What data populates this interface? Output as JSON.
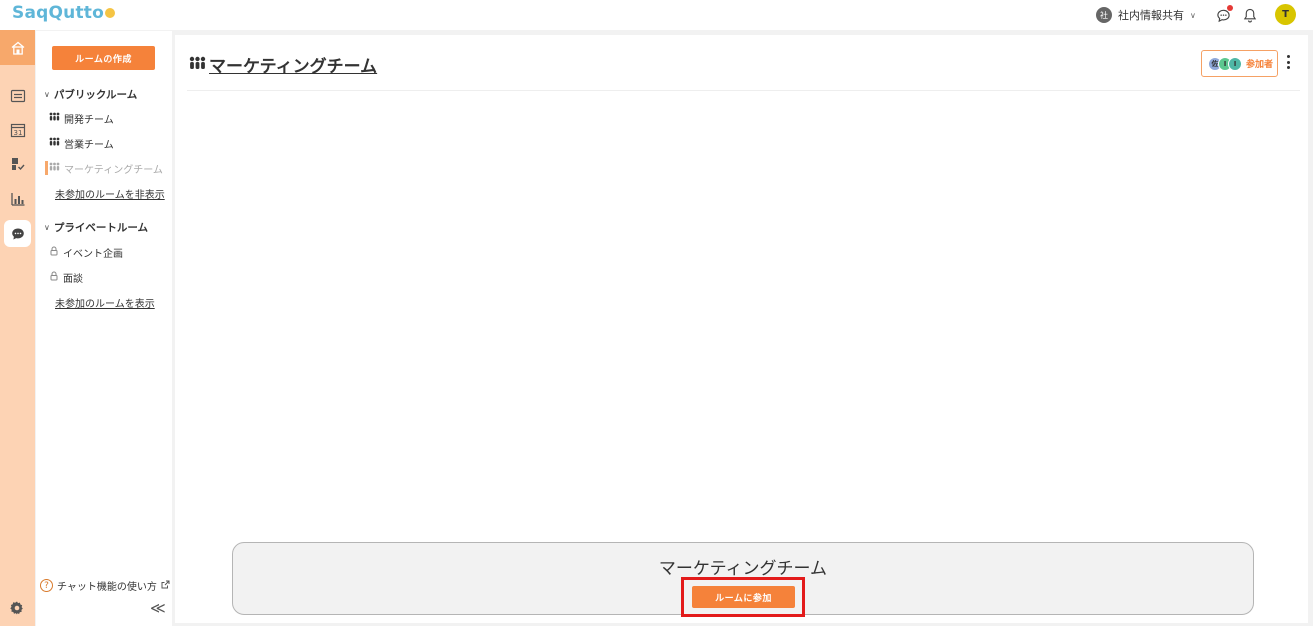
{
  "app": {
    "logo_text": "SaqQutto"
  },
  "topbar": {
    "workspace_badge": "社",
    "workspace_name": "社内情報共有",
    "user_initial": "T"
  },
  "rail": {
    "items": [
      "home-icon",
      "list-icon",
      "calendar-icon",
      "task-icon",
      "chart-icon",
      "chat-icon",
      "gear-icon"
    ],
    "calendar_number": "31"
  },
  "sidebar": {
    "create_room": "ルームの作成",
    "public_section": "パブリックルーム",
    "public_rooms": [
      "開発チーム",
      "営業チーム",
      "マーケティングチーム"
    ],
    "hide_unjoined": "未参加のルームを非表示",
    "private_section": "プライベートルーム",
    "private_rooms": [
      "イベント企画",
      "面談"
    ],
    "show_unjoined": "未参加のルームを表示",
    "help": "チャット機能の使い方",
    "collapse": "≪"
  },
  "main": {
    "room_title": "マーケティングチーム",
    "members_label": "参加者",
    "member_initials": [
      "佐",
      "I",
      "I"
    ]
  },
  "join_panel": {
    "title": "マーケティングチーム",
    "button": "ルームに参加"
  },
  "colors": {
    "accent": "#f5823a",
    "rail_bg": "#fdd3b4",
    "highlight_outline": "#e31b1b"
  }
}
